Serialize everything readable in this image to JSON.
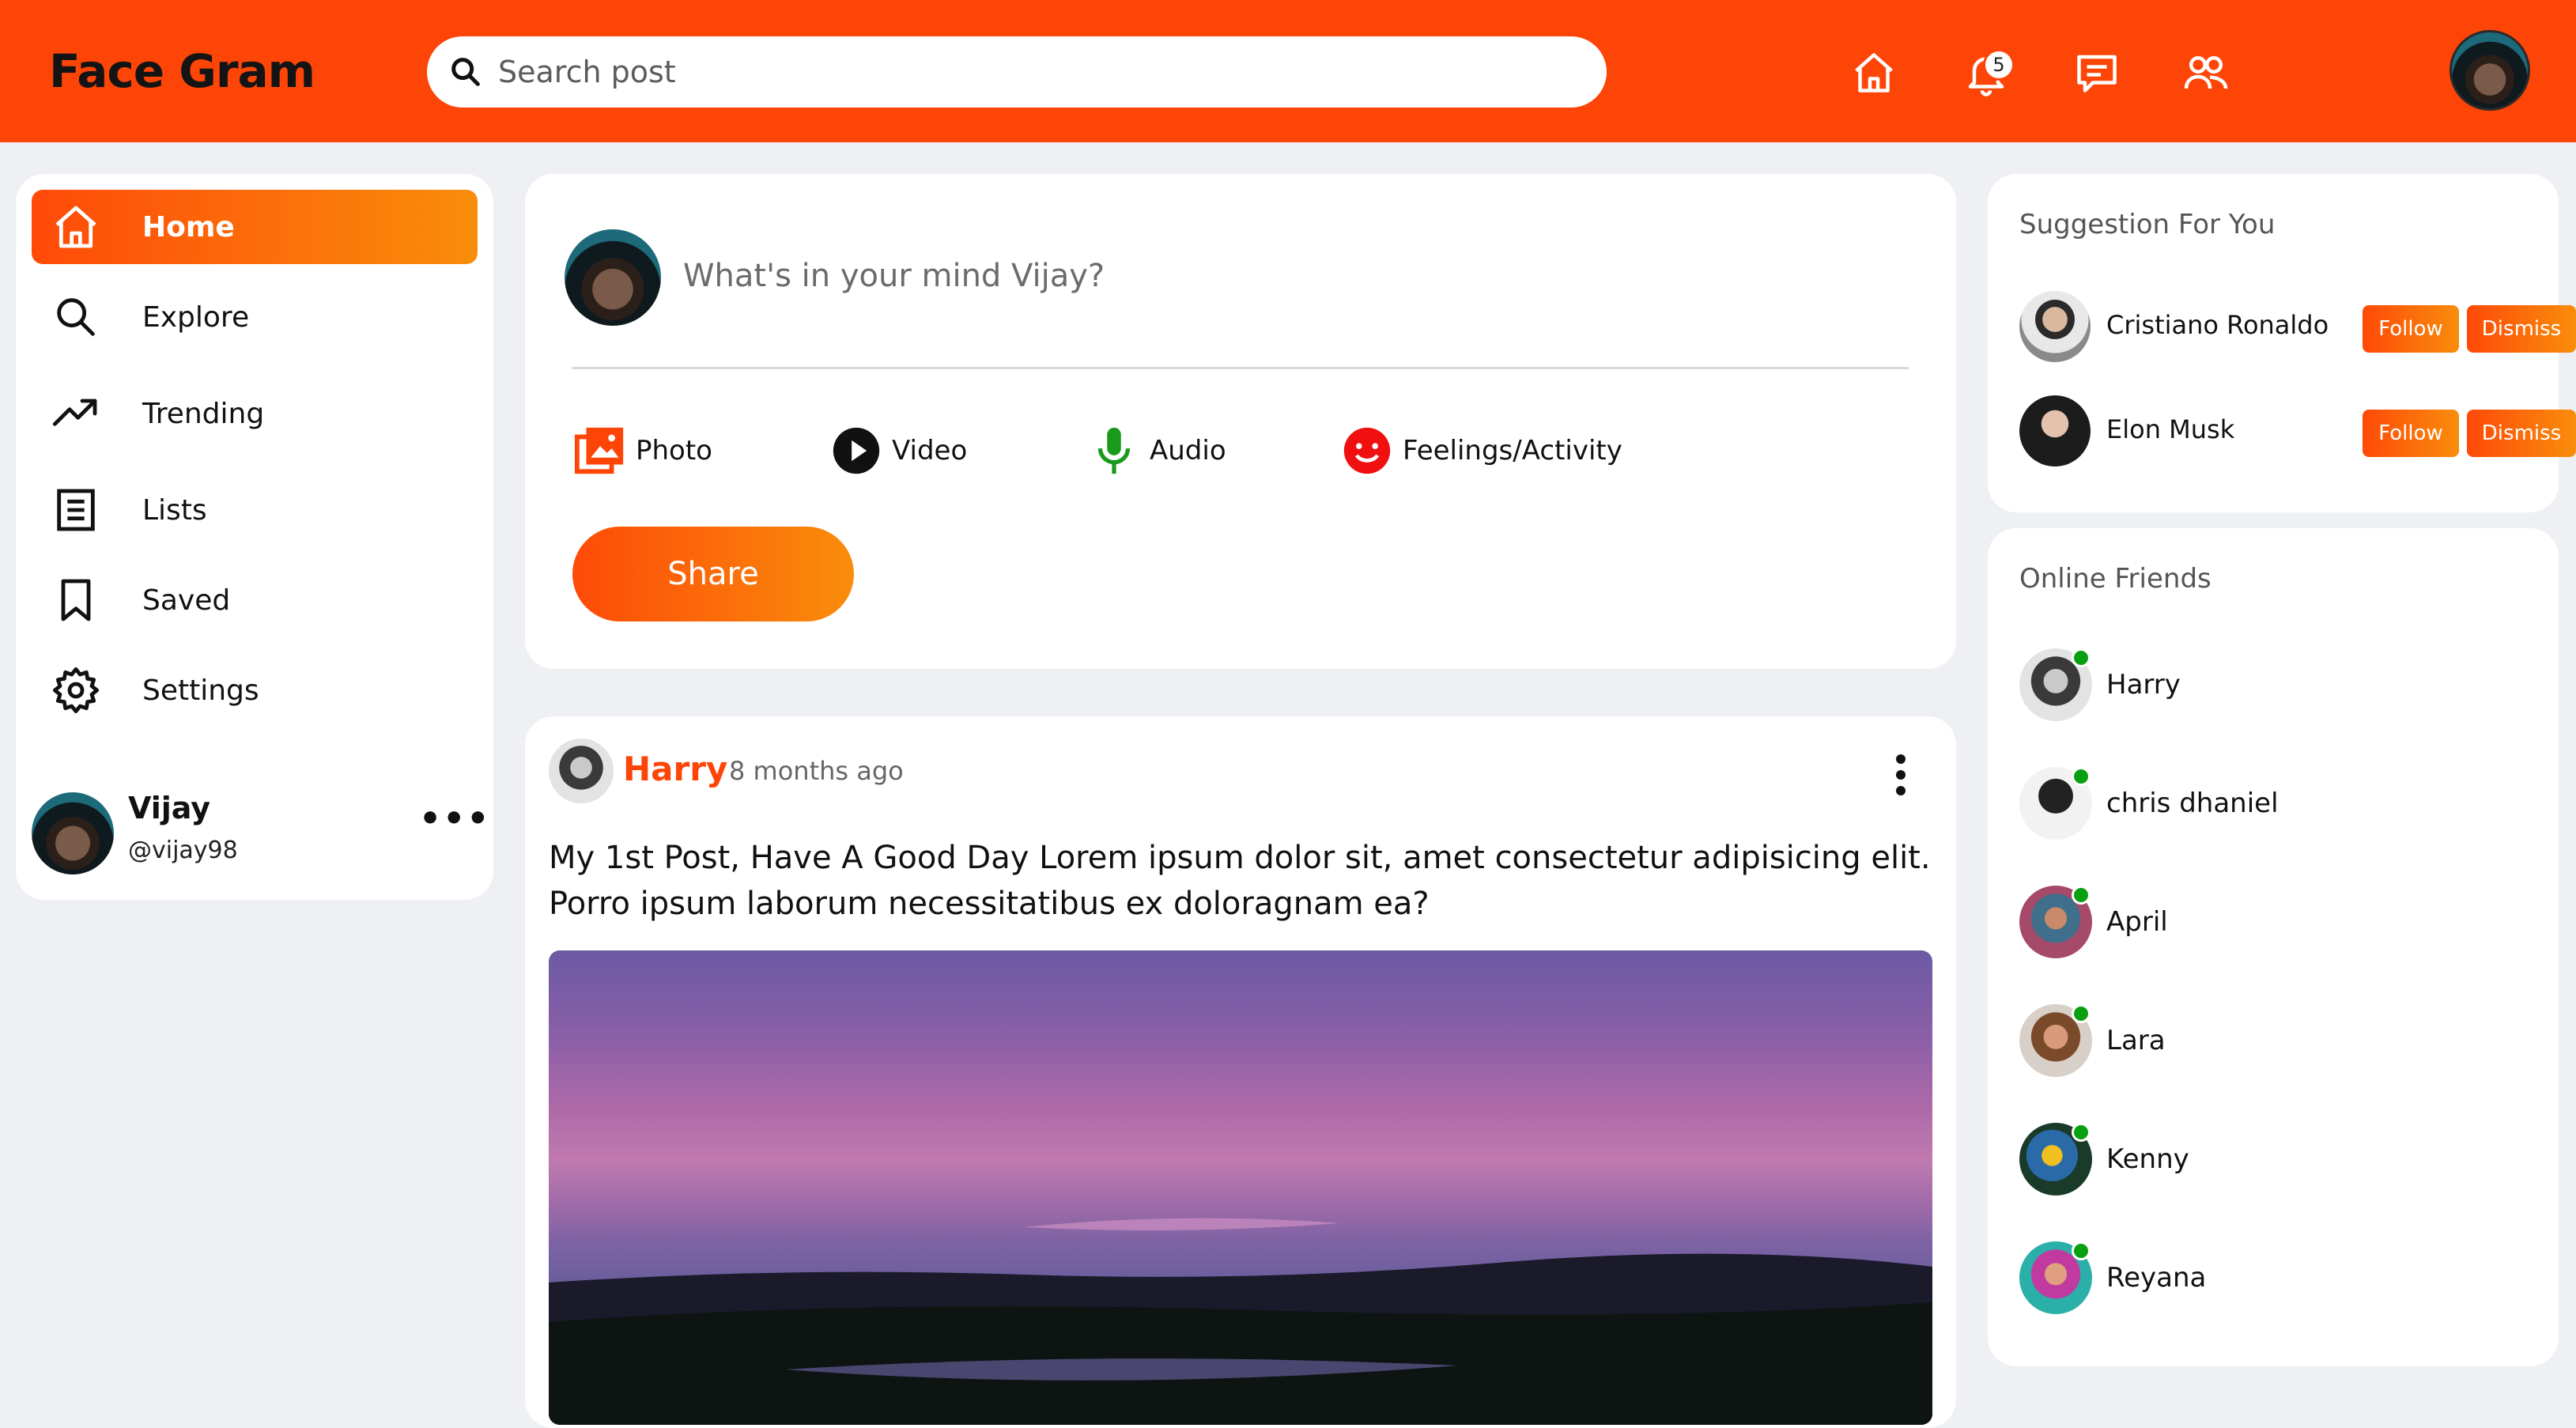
{
  "header": {
    "brand": "Face Gram",
    "search_placeholder": "Search post",
    "notification_count": "5"
  },
  "sidebar": {
    "items": [
      {
        "label": "Home",
        "icon": "home-icon",
        "active": true
      },
      {
        "label": "Explore",
        "icon": "search-icon"
      },
      {
        "label": "Trending",
        "icon": "trending-icon"
      },
      {
        "label": "Lists",
        "icon": "list-icon"
      },
      {
        "label": "Saved",
        "icon": "bookmark-icon"
      },
      {
        "label": "Settings",
        "icon": "gear-icon"
      }
    ],
    "profile": {
      "name": "Vijay",
      "handle": "@vijay98"
    }
  },
  "composer": {
    "placeholder": "What's in your mind Vijay?",
    "actions": [
      {
        "label": "Photo",
        "icon": "photo-icon"
      },
      {
        "label": "Video",
        "icon": "play-icon"
      },
      {
        "label": "Audio",
        "icon": "microphone-icon"
      },
      {
        "label": "Feelings/Activity",
        "icon": "smiley-icon"
      }
    ],
    "share_label": "Share"
  },
  "post": {
    "author": "Harry",
    "time": "8 months ago",
    "text": "My 1st Post, Have A Good Day Lorem ipsum dolor sit, amet consectetur adipisicing elit. Porro ipsum laborum necessitatibus ex doloragnam ea?"
  },
  "suggestions": {
    "title": "Suggestion For You",
    "follow_label": "Follow",
    "dismiss_label": "Dismiss",
    "people": [
      {
        "name": "Cristiano Ronaldo"
      },
      {
        "name": "Elon Musk"
      }
    ]
  },
  "online_friends": {
    "title": "Online Friends",
    "friends": [
      {
        "name": "Harry"
      },
      {
        "name": "chris dhaniel"
      },
      {
        "name": "April"
      },
      {
        "name": "Lara"
      },
      {
        "name": "Kenny"
      },
      {
        "name": "Reyana"
      }
    ]
  },
  "colors": {
    "accent": "#fe4508",
    "accent_gradient_end": "#f98d0b",
    "online_dot": "#08a010",
    "background": "#eff0f4"
  }
}
